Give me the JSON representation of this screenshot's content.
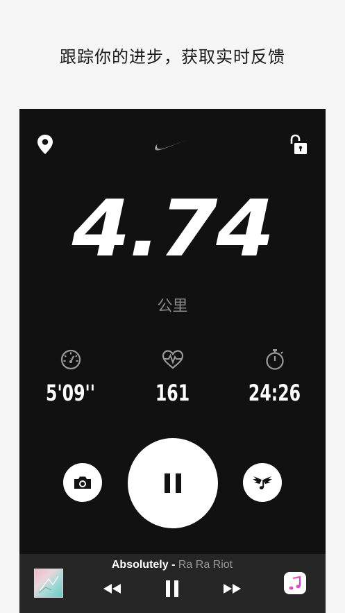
{
  "headline": "跟踪你的进步，获取实时反馈",
  "run": {
    "distance": "4.74",
    "distance_unit": "公里",
    "stats": [
      {
        "icon": "speedometer-icon",
        "value": "5'09''"
      },
      {
        "icon": "heart-rate-icon",
        "value": "161"
      },
      {
        "icon": "stopwatch-icon",
        "value": "24:26"
      }
    ]
  },
  "controls": {
    "camera_icon": "camera-icon",
    "pause_icon": "pause-icon",
    "powersong_icon": "winged-music-note-icon"
  },
  "player": {
    "title": "Absolutely",
    "separator": " - ",
    "artist": "Ra Ra Riot",
    "prev_icon": "rewind-icon",
    "pause_icon": "pause-icon",
    "next_icon": "fast-forward-icon",
    "app_icon": "apple-music-icon"
  },
  "colors": {
    "page_background": "#f5f5f5",
    "phone_background": "#111111",
    "player_background": "#262626",
    "accent_white": "#ffffff",
    "unit_gray": "#8a8a8a"
  }
}
